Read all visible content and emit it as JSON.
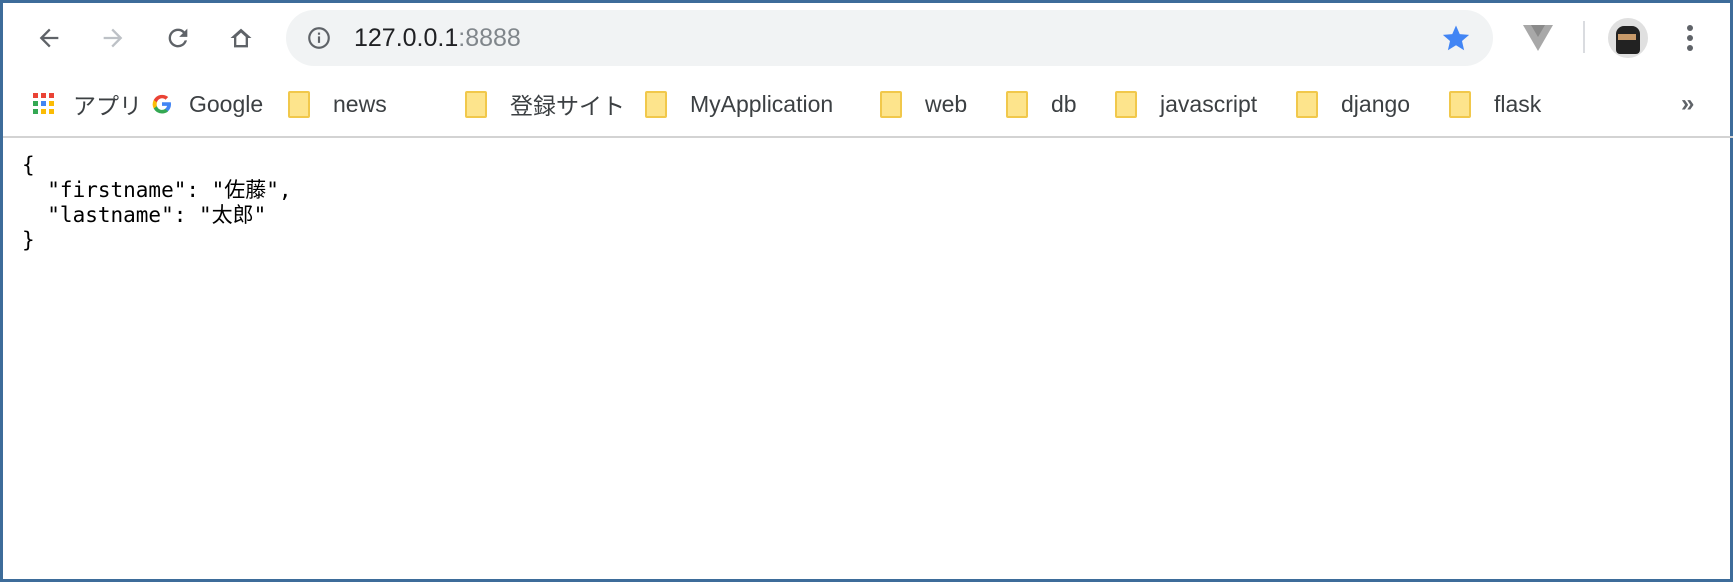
{
  "toolbar": {
    "url_host": "127.0.0.1",
    "url_port": ":8888"
  },
  "bookmarks": {
    "apps_label": "アプリ",
    "items": [
      "Google",
      "news",
      "登録サイト",
      "MyApplication",
      "web",
      "db",
      "javascript",
      "django",
      "flask"
    ],
    "overflow": "»"
  },
  "content": {
    "lines": [
      "{",
      "  \"firstname\": \"佐藤\",",
      "  \"lastname\": \"太郎\"",
      "}"
    ]
  },
  "colors": {
    "star": "#4285f4",
    "folder": "#fde48c",
    "frame": "#3d6c9a"
  }
}
